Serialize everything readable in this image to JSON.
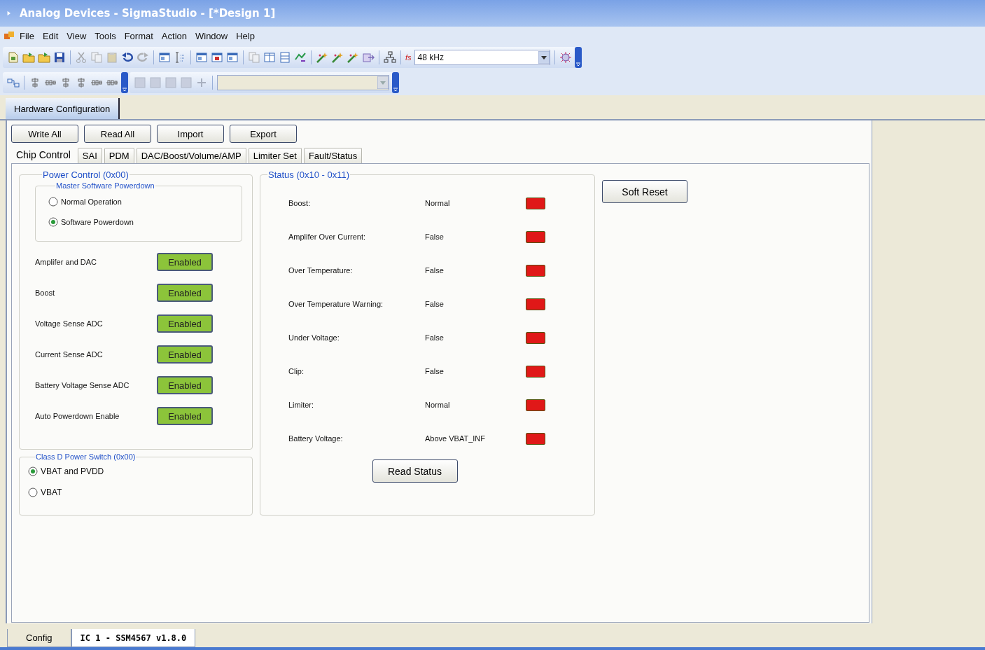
{
  "window": {
    "title": "Analog Devices - SigmaStudio - [*Design 1]"
  },
  "menu": [
    "File",
    "Edit",
    "View",
    "Tools",
    "Format",
    "Action",
    "Window",
    "Help"
  ],
  "toolbar": {
    "sample_rate_label": "fs",
    "sample_rate": "48 kHz"
  },
  "document_tabs": [
    {
      "label": "Hardware Configuration",
      "selected": true
    }
  ],
  "actions": [
    "Write All",
    "Read All",
    "Import",
    "Export"
  ],
  "tabs": [
    {
      "label": "Chip Control",
      "selected": true
    },
    {
      "label": "SAI",
      "selected": false
    },
    {
      "label": "PDM",
      "selected": false
    },
    {
      "label": "DAC/Boost/Volume/AMP",
      "selected": false
    },
    {
      "label": "Limiter Set",
      "selected": false
    },
    {
      "label": "Fault/Status",
      "selected": false
    }
  ],
  "power_control": {
    "title": "Power Control (0x00)",
    "master_powerdown": {
      "title": "Master Software Powerdown",
      "options": [
        {
          "label": "Normal Operation",
          "selected": false
        },
        {
          "label": "Software Powerdown",
          "selected": true
        }
      ]
    },
    "blocks": [
      {
        "name": "Amplifer and DAC",
        "button": "Enabled",
        "on": true
      },
      {
        "name": "Boost",
        "button": "Enabled",
        "on": true
      },
      {
        "name": "Voltage Sense ADC",
        "button": "Enabled",
        "on": true
      },
      {
        "name": "Current Sense ADC",
        "button": "Enabled",
        "on": true
      },
      {
        "name": "Battery Voltage Sense ADC",
        "button": "Enabled",
        "on": true
      },
      {
        "name": "Auto Powerdown Enable",
        "button": "Enabled",
        "on": true
      }
    ]
  },
  "class_d_power_switch": {
    "title": "Class D Power Switch (0x00)",
    "options": [
      {
        "label": "VBAT and PVDD",
        "selected": true
      },
      {
        "label": "VBAT",
        "selected": false
      }
    ]
  },
  "status": {
    "title": "Status (0x10 - 0x11)",
    "rows": [
      {
        "label": "Boost:",
        "value": "Normal",
        "color": "#e01818"
      },
      {
        "label": "Amplifer Over Current:",
        "value": "False",
        "color": "#e01818"
      },
      {
        "label": "Over Temperature:",
        "value": "False",
        "color": "#e01818"
      },
      {
        "label": "Over Temperature Warning:",
        "value": "False",
        "color": "#e01818"
      },
      {
        "label": "Under Voltage:",
        "value": "False",
        "color": "#e01818"
      },
      {
        "label": "Clip:",
        "value": "False",
        "color": "#e01818"
      },
      {
        "label": "Limiter:",
        "value": "Normal",
        "color": "#e01818"
      },
      {
        "label": "Battery Voltage:",
        "value": "Above VBAT_INF",
        "color": "#e01818"
      }
    ],
    "read_button": "Read Status"
  },
  "soft_reset": "Soft Reset",
  "bottom_tabs": [
    {
      "label": "Config",
      "selected": false
    },
    {
      "label": "IC 1 - SSM4567 v1.8.0",
      "selected": true
    }
  ]
}
